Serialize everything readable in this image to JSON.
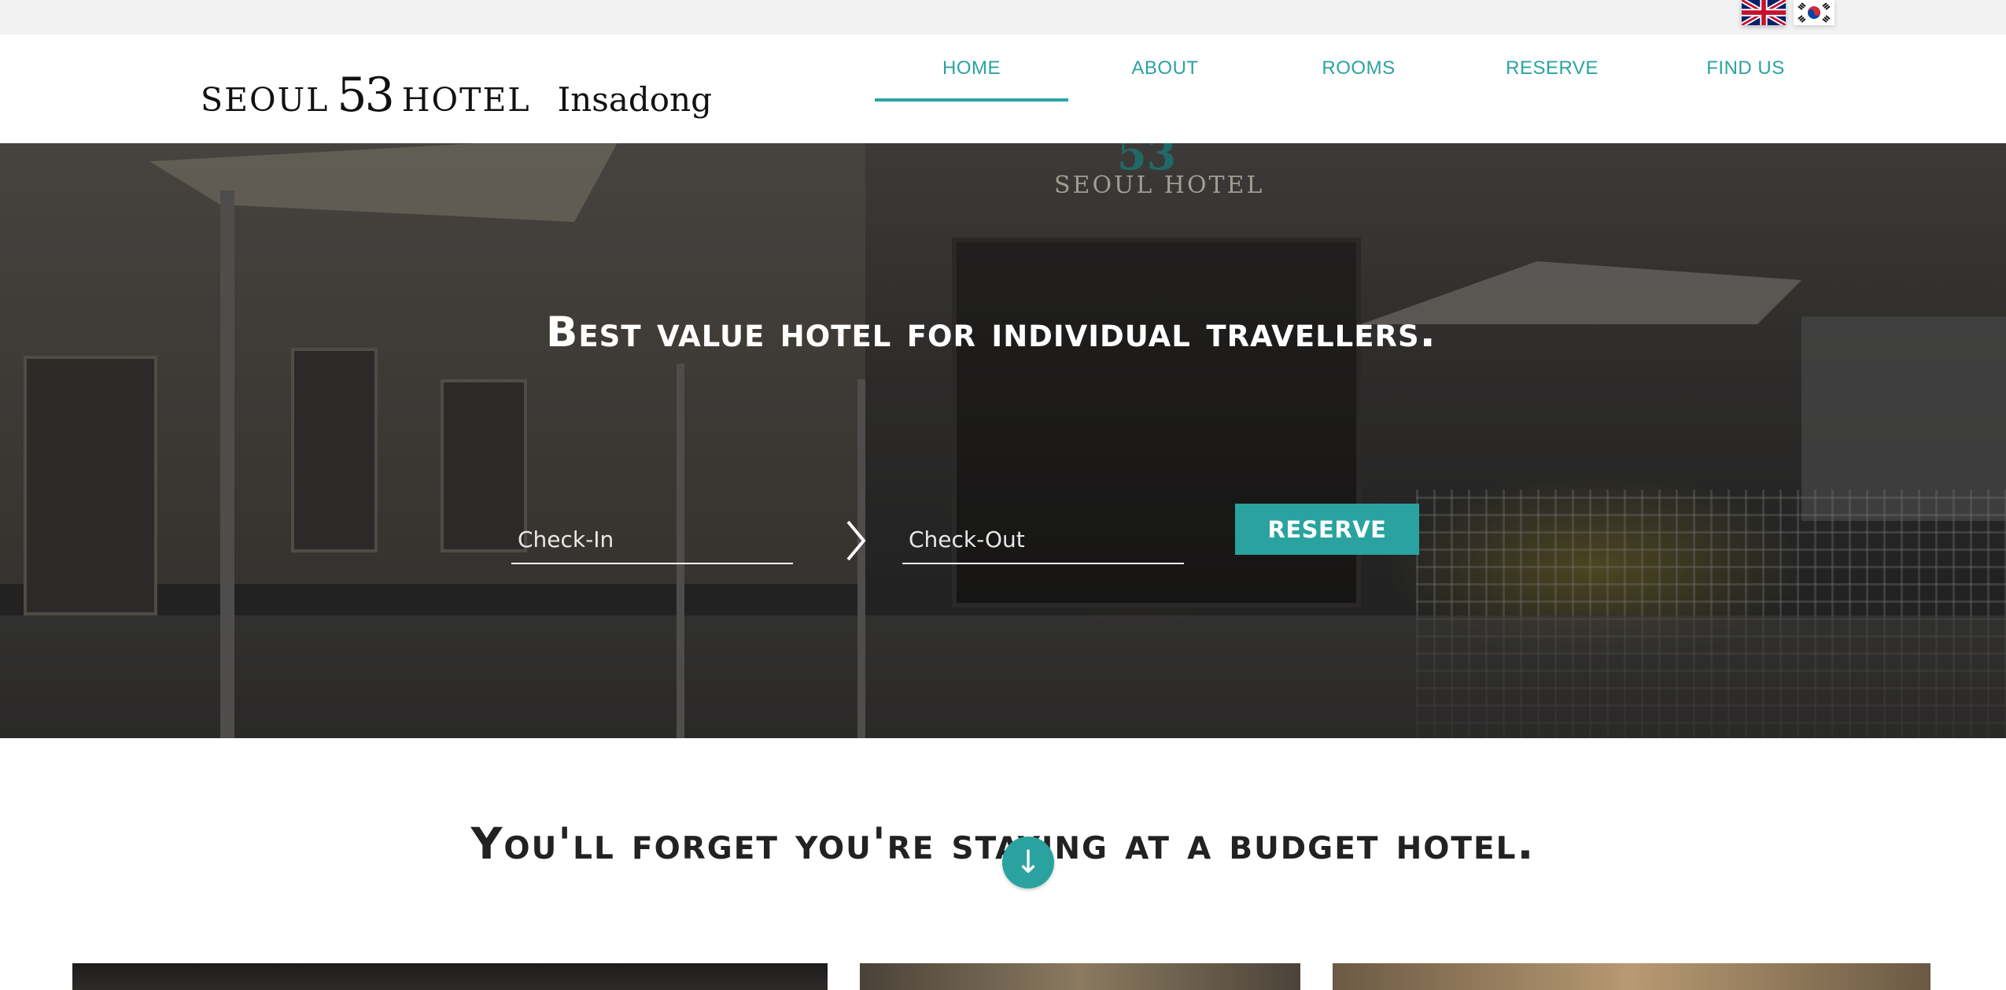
{
  "languages": [
    {
      "name": "uk-flag-icon",
      "label": "English"
    },
    {
      "name": "korea-flag-icon",
      "label": "Korean"
    }
  ],
  "logo": {
    "word1": "SEOUL",
    "number": "53",
    "word2": "HOTEL",
    "place": "Insadong"
  },
  "nav": {
    "items": [
      {
        "label": "HOME",
        "active": true
      },
      {
        "label": "ABOUT",
        "active": false
      },
      {
        "label": "ROOMS",
        "active": false
      },
      {
        "label": "RESERVE",
        "active": false
      },
      {
        "label": "FIND US",
        "active": false
      }
    ]
  },
  "hero": {
    "title": "Best value hotel for individual travellers.",
    "sign_number": "53",
    "sign_text": "SEOUL HOTEL",
    "checkin_placeholder": "Check-In",
    "checkout_placeholder": "Check-Out",
    "reserve_label": "RESERVE"
  },
  "section": {
    "tagline": "You'll forget you're staying at a budget hotel.",
    "scroll_glyph": "↓"
  },
  "colors": {
    "accent": "#2aa3a0",
    "topbar": "#f2f2f2",
    "text_dark": "#222222"
  }
}
